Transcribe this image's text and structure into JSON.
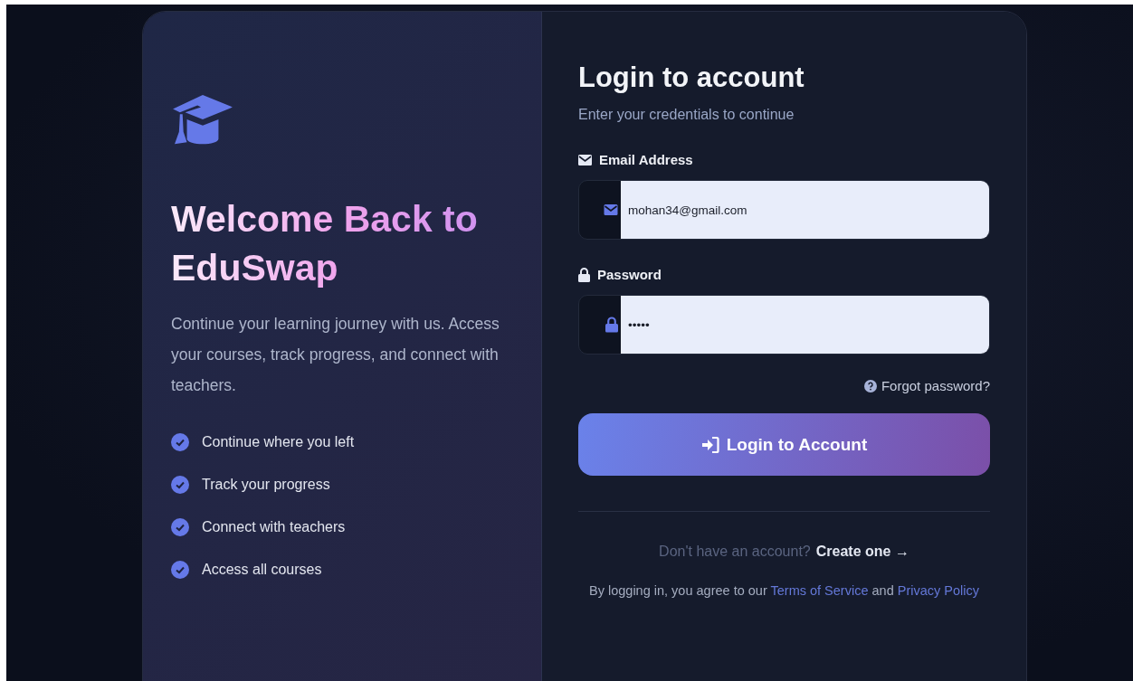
{
  "hero": {
    "title_start": "Welcome",
    "title_end": "Back to EduSwap",
    "description": "Continue your learning journey with us. Access your courses, track progress, and connect with teachers.",
    "features": [
      {
        "label": "Continue where you left",
        "checked": true
      },
      {
        "label": "Track your progress",
        "checked": true
      },
      {
        "label": "Connect with teachers",
        "checked": true
      },
      {
        "label": "Access all courses",
        "checked": true
      }
    ]
  },
  "login": {
    "title": "Login to account",
    "subtitle": "Enter your credentials to continue",
    "fields": [
      {
        "kind": "email",
        "label": "Email Address",
        "value": "mohan34@gmail.com"
      },
      {
        "kind": "password",
        "label": "Password",
        "value": "•••••"
      }
    ],
    "forgot": "Forgot password?",
    "submit": "Login to Account",
    "signup_prompt": "Don't have an account?",
    "signup_link": "Create one",
    "signup_arrow": "→",
    "legal": {
      "before": "By logging in, you agree to our",
      "terms": "Terms of Service",
      "and": "and",
      "privacy": "Privacy Policy"
    }
  }
}
